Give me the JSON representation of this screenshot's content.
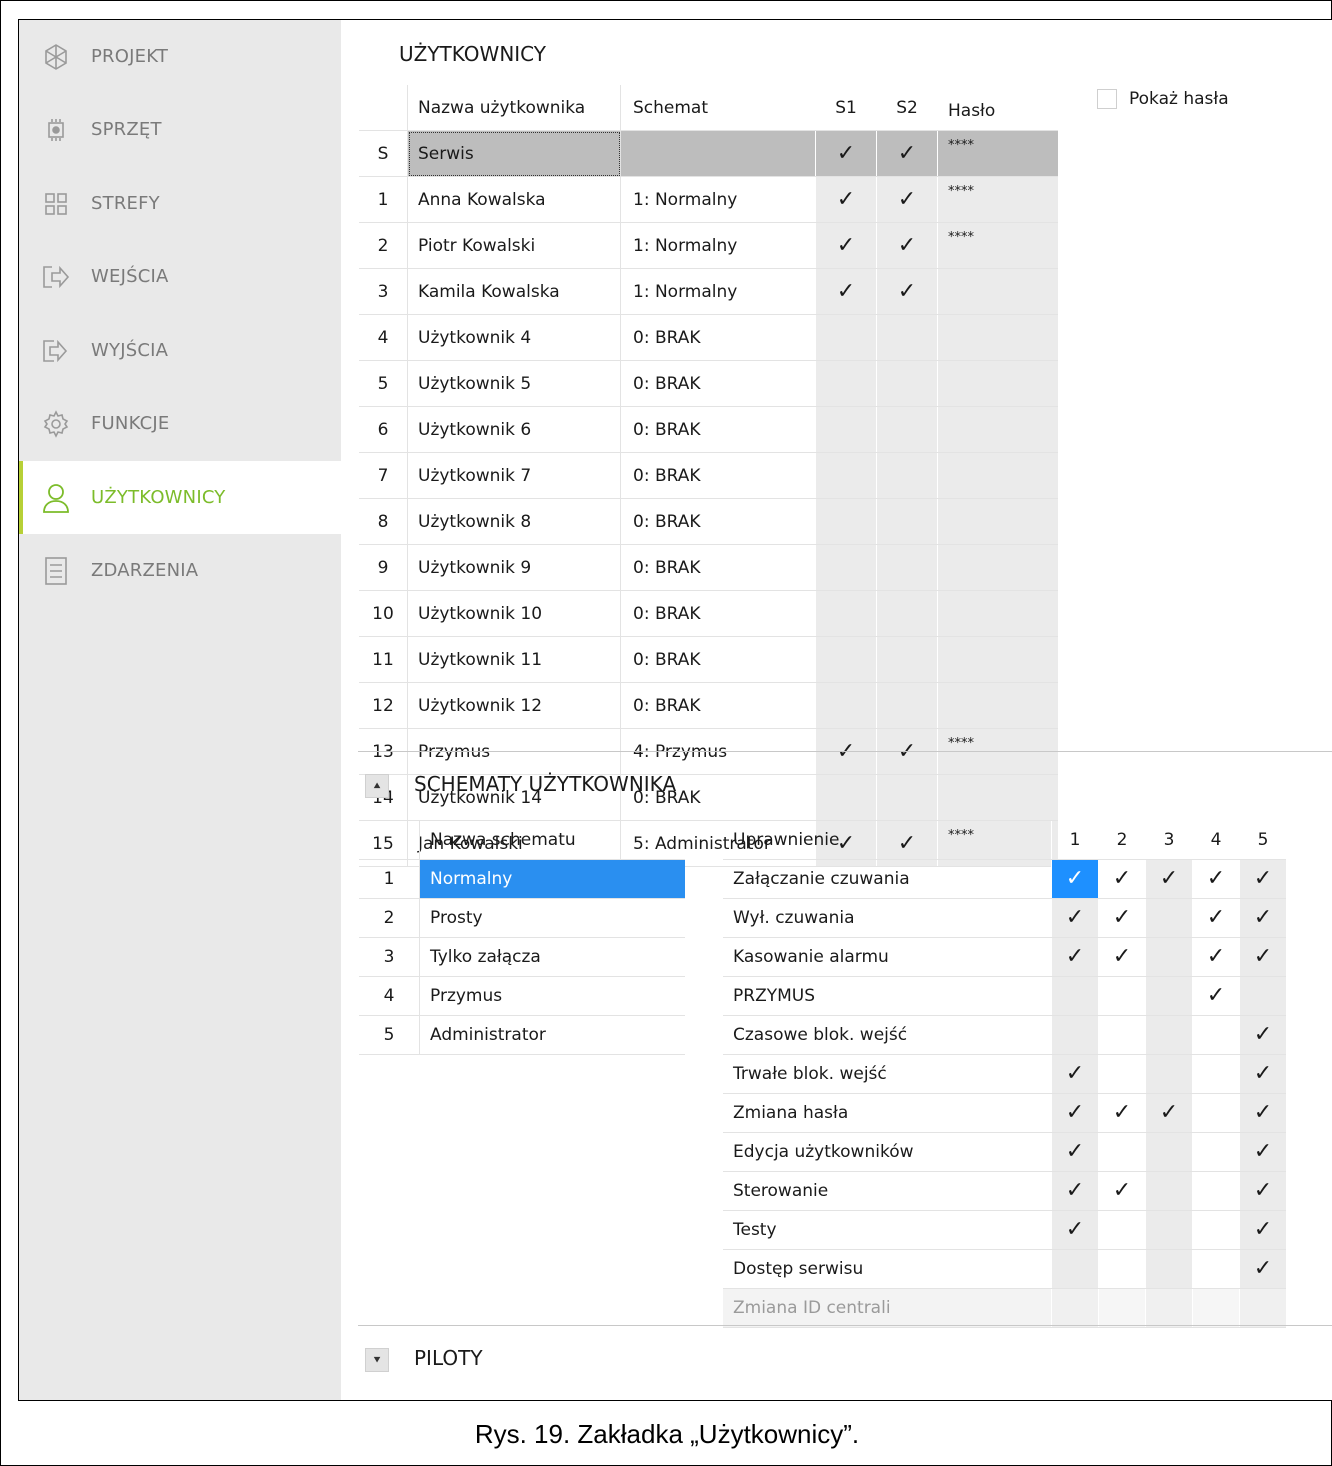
{
  "sidebar": {
    "items": [
      {
        "label": "PROJEKT",
        "icon": "project-icon",
        "active": false
      },
      {
        "label": "SPRZĘT",
        "icon": "hardware-chip-icon",
        "active": false
      },
      {
        "label": "STREFY",
        "icon": "zones-grid-icon",
        "active": false
      },
      {
        "label": "WEJŚCIA",
        "icon": "input-arrow-icon",
        "active": false
      },
      {
        "label": "WYJŚCIA",
        "icon": "output-arrow-icon",
        "active": false
      },
      {
        "label": "FUNKCJE",
        "icon": "gear-icon",
        "active": false
      },
      {
        "label": "UŻYTKOWNICY",
        "icon": "user-icon",
        "active": true
      },
      {
        "label": "ZDARZENIA",
        "icon": "event-list-icon",
        "active": false
      }
    ]
  },
  "users": {
    "title": "UŻYTKOWNICY",
    "show_passwords_label": "Pokaż hasła",
    "headers": {
      "name": "Nazwa użytkownika",
      "scheme": "Schemat",
      "s1": "S1",
      "s2": "S2",
      "password": "Hasło"
    },
    "rows": [
      {
        "num": "S",
        "name": "Serwis",
        "scheme": "",
        "s1": "✓",
        "s2": "✓",
        "pw": "****"
      },
      {
        "num": "1",
        "name": "Anna Kowalska",
        "scheme": "1: Normalny",
        "s1": "✓",
        "s2": "✓",
        "pw": "****"
      },
      {
        "num": "2",
        "name": "Piotr Kowalski",
        "scheme": "1: Normalny",
        "s1": "✓",
        "s2": "✓",
        "pw": "****"
      },
      {
        "num": "3",
        "name": "Kamila Kowalska",
        "scheme": "1: Normalny",
        "s1": "✓",
        "s2": "✓",
        "pw": ""
      },
      {
        "num": "4",
        "name": "Użytkownik 4",
        "scheme": "0: BRAK",
        "s1": "",
        "s2": "",
        "pw": ""
      },
      {
        "num": "5",
        "name": "Użytkownik 5",
        "scheme": "0: BRAK",
        "s1": "",
        "s2": "",
        "pw": ""
      },
      {
        "num": "6",
        "name": "Użytkownik 6",
        "scheme": "0: BRAK",
        "s1": "",
        "s2": "",
        "pw": ""
      },
      {
        "num": "7",
        "name": "Użytkownik 7",
        "scheme": "0: BRAK",
        "s1": "",
        "s2": "",
        "pw": ""
      },
      {
        "num": "8",
        "name": "Użytkownik 8",
        "scheme": "0: BRAK",
        "s1": "",
        "s2": "",
        "pw": ""
      },
      {
        "num": "9",
        "name": "Użytkownik 9",
        "scheme": "0: BRAK",
        "s1": "",
        "s2": "",
        "pw": ""
      },
      {
        "num": "10",
        "name": "Użytkownik 10",
        "scheme": "0: BRAK",
        "s1": "",
        "s2": "",
        "pw": ""
      },
      {
        "num": "11",
        "name": "Użytkownik 11",
        "scheme": "0: BRAK",
        "s1": "",
        "s2": "",
        "pw": ""
      },
      {
        "num": "12",
        "name": "Użytkownik 12",
        "scheme": "0: BRAK",
        "s1": "",
        "s2": "",
        "pw": ""
      },
      {
        "num": "13",
        "name": "Przymus",
        "scheme": "4: Przymus",
        "s1": "✓",
        "s2": "✓",
        "pw": "****"
      },
      {
        "num": "14",
        "name": "Użytkownik 14",
        "scheme": "0: BRAK",
        "s1": "",
        "s2": "",
        "pw": ""
      },
      {
        "num": "15",
        "name": "Jan Kowalski",
        "scheme": "5: Administrator",
        "s1": "✓",
        "s2": "✓",
        "pw": "****"
      }
    ]
  },
  "schemes": {
    "title": "SCHEMATY UŻYTKOWNIKA",
    "collapse_icon": "chevron-double-up-icon",
    "name_header": "Nazwa schematu",
    "list": [
      {
        "num": "1",
        "name": "Normalny",
        "selected": true
      },
      {
        "num": "2",
        "name": "Prosty",
        "selected": false
      },
      {
        "num": "3",
        "name": "Tylko załącza",
        "selected": false
      },
      {
        "num": "4",
        "name": "Przymus",
        "selected": false
      },
      {
        "num": "5",
        "name": "Administrator",
        "selected": false
      }
    ],
    "perm_header": "Uprawnienie",
    "columns": [
      "1",
      "2",
      "3",
      "4",
      "5"
    ],
    "permissions": [
      {
        "name": "Załączanie czuwania",
        "checks": [
          "✓",
          "✓",
          "✓",
          "✓",
          "✓"
        ],
        "disabled": false
      },
      {
        "name": "Wył. czuwania",
        "checks": [
          "✓",
          "✓",
          "",
          "✓",
          "✓"
        ],
        "disabled": false
      },
      {
        "name": "Kasowanie alarmu",
        "checks": [
          "✓",
          "✓",
          "",
          "✓",
          "✓"
        ],
        "disabled": false
      },
      {
        "name": "PRZYMUS",
        "checks": [
          "",
          "",
          "",
          "✓",
          ""
        ],
        "disabled": false
      },
      {
        "name": "Czasowe blok. wejść",
        "checks": [
          "",
          "",
          "",
          "",
          "✓"
        ],
        "disabled": false
      },
      {
        "name": "Trwałe blok. wejść",
        "checks": [
          "✓",
          "",
          "",
          "",
          "✓"
        ],
        "disabled": false
      },
      {
        "name": "Zmiana hasła",
        "checks": [
          "✓",
          "✓",
          "✓",
          "",
          "✓"
        ],
        "disabled": false
      },
      {
        "name": "Edycja użytkowników",
        "checks": [
          "✓",
          "",
          "",
          "",
          "✓"
        ],
        "disabled": false
      },
      {
        "name": "Sterowanie",
        "checks": [
          "✓",
          "✓",
          "",
          "",
          "✓"
        ],
        "disabled": false
      },
      {
        "name": "Testy",
        "checks": [
          "✓",
          "",
          "",
          "",
          "✓"
        ],
        "disabled": false
      },
      {
        "name": "Dostęp serwisu",
        "checks": [
          "",
          "",
          "",
          "",
          "✓"
        ],
        "disabled": false
      },
      {
        "name": "Zmiana ID centrali",
        "checks": [
          "",
          "",
          "",
          "",
          ""
        ],
        "disabled": true
      }
    ]
  },
  "remotes": {
    "title": "PILOTY",
    "expand_icon": "chevron-double-down-icon"
  },
  "caption": "Rys. 19. Zakładka „Użytkownicy”."
}
